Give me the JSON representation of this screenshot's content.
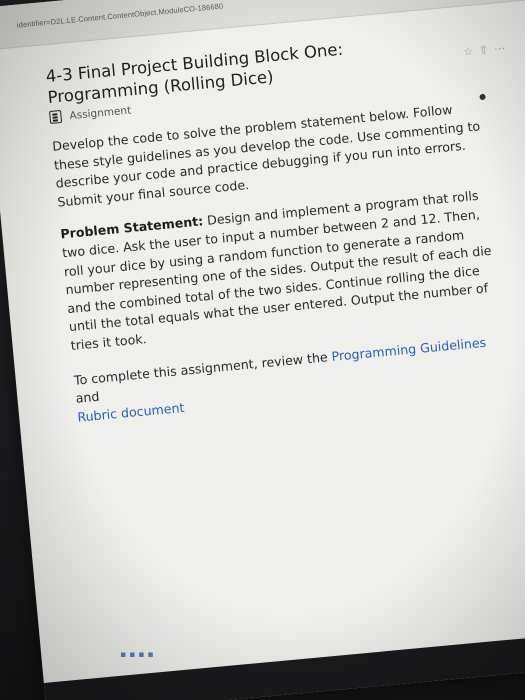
{
  "browser": {
    "url_fragment": "identifier=D2L.LE.Content.ContentObject.ModuleCO-186680"
  },
  "toolbar": {
    "icons": [
      "star-icon",
      "share-icon",
      "more-icon"
    ]
  },
  "assignment": {
    "title_line1": "4-3 Final Project Building Block One:",
    "title_line2": "Programming (Rolling Dice)",
    "type_label": "Assignment",
    "intro": "Develop the code to solve the problem statement below. Follow these style guidelines as you develop the code. Use commenting to describe your code and practice debugging if you run into errors. Submit your final source code.",
    "problem_label": "Problem Statement:",
    "problem_text": "Design and implement a program that rolls two dice. Ask the user to input a number between 2 and 12. Then, roll your dice by using a random function to generate a random number representing one of the sides. Output the result of each die and the combined total of the two sides. Continue rolling the dice until the total equals what the user entered. Output the number of tries it took.",
    "complete_prefix": "To complete this assignment, review the ",
    "guidelines_link": "Programming Guidelines",
    "complete_and": " and",
    "rubric_link": "Rubric document"
  },
  "colors": {
    "link": "#2a5fb8",
    "page_bg": "#efefec"
  }
}
